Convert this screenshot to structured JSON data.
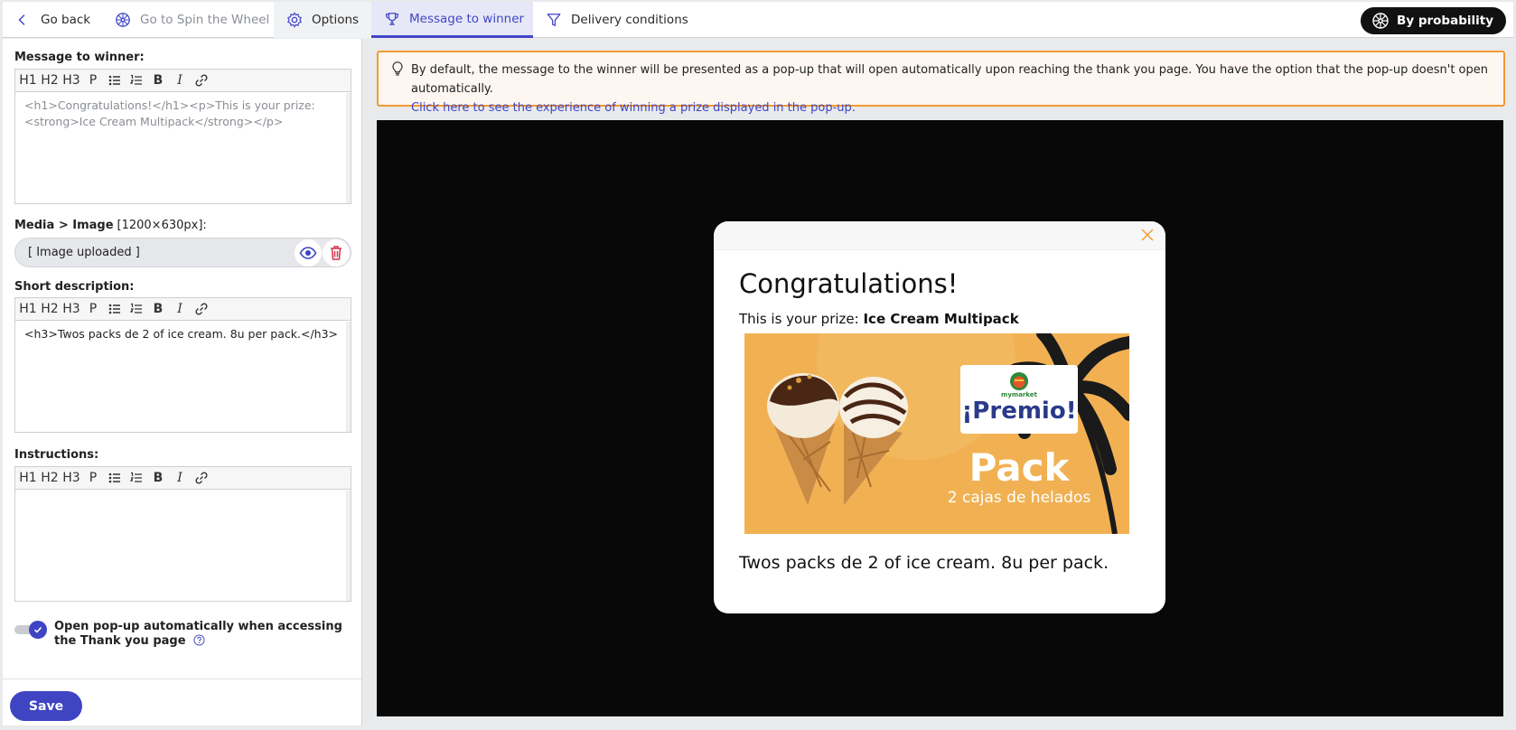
{
  "topbar": {
    "tabs": [
      {
        "label": "Go back"
      },
      {
        "label": "Go to Spin the Wheel"
      },
      {
        "label": "Options"
      },
      {
        "label": "Message to winner"
      },
      {
        "label": "Delivery conditions"
      }
    ],
    "probability_label": "By probability"
  },
  "left": {
    "message_label": "Message to winner:",
    "toolbar": {
      "h1": "H1",
      "h2": "H2",
      "h3": "H3",
      "p": "P",
      "bold": "B",
      "italic": "I"
    },
    "message_value": "<h1>Congratulations!</h1><p>This is your prize: <strong>Ice Cream Multipack</strong></p>",
    "media_label": "Media > Image",
    "media_size": "[1200×630px]:",
    "media_value": "[ Image uploaded ]",
    "short_label": "Short description:",
    "short_value": "<h3>Twos packs de 2 of ice cream. 8u per pack.</h3>",
    "instructions_label": "Instructions:",
    "instructions_value": "",
    "toggle_label": "Open pop-up automatically when accessing the Thank you page",
    "toggle_on": true,
    "save_label": "Save"
  },
  "info": {
    "text": "By default, the message to the winner will be presented as a pop-up that will open automatically upon reaching the thank you page. You have the option that the pop-up doesn't open automatically.",
    "link": "Click here to see the experience of winning a prize displayed in the pop-up."
  },
  "popup": {
    "title": "Congratulations!",
    "prize_prefix": "This is your prize:",
    "prize_name": "Ice Cream Multipack",
    "banner_logo": "mymarket",
    "banner_premio": "¡Premio!",
    "banner_pack": "Pack",
    "banner_sub": "2 cajas de helados",
    "description": "Twos packs de 2 of ice cream. 8u per pack."
  },
  "colors": {
    "accent": "#3f44c2",
    "warning_border": "#f29a2e",
    "danger": "#d6324a",
    "banner": "#f1b153"
  }
}
